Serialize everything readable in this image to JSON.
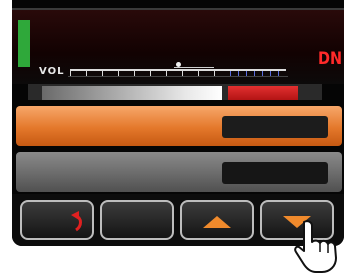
{
  "display": {
    "volume_label": "VOL",
    "mode_label": "DN"
  },
  "colors": {
    "level_bar": "#2fa83a",
    "mode_label": "#ff2a2a",
    "orange_row": "#e4782b",
    "gray_row": "#6b6b6b",
    "arrow": "#f08a2c"
  },
  "buttons": [
    {
      "icon": "back-arrow-icon"
    },
    {
      "icon": "none"
    },
    {
      "icon": "up-triangle-icon"
    },
    {
      "icon": "down-triangle-icon"
    }
  ]
}
